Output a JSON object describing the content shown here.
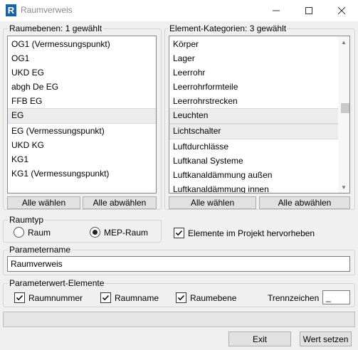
{
  "window": {
    "title": "Raumverweis",
    "app_icon_letter": "R",
    "controls": {
      "minimize": "minimize-icon",
      "maximize": "maximize-icon",
      "close": "close-icon"
    }
  },
  "levels": {
    "legend": "Raumebenen: 1 gewählt",
    "items": [
      "OG1 (Vermessungspunkt)",
      "OG1",
      "UKD EG",
      "abgh De EG",
      "FFB EG",
      "EG",
      "EG (Vermessungspunkt)",
      "UKD KG",
      "KG1",
      "KG1 (Vermessungspunkt)"
    ],
    "selected_index": 5,
    "select_all": "Alle wählen",
    "deselect_all": "Alle abwählen"
  },
  "categories": {
    "legend": "Element-Kategorien: 3 gewählt",
    "items": [
      "Körper",
      "Lager",
      "Leerrohr",
      "Leerrohrformteile",
      "Leerrohrstrecken",
      "Leuchten",
      "Lichtschalter",
      "Luftdurchlässe",
      "Luftkanal Systeme",
      "Luftkanaldämmung außen",
      "Luftkanaldämmung innen"
    ],
    "selected_indices": [
      5,
      6
    ],
    "select_all": "Alle wählen",
    "deselect_all": "Alle abwählen",
    "scroll_position": 0.45
  },
  "raumtyp": {
    "legend": "Raumtyp",
    "option_raum": "Raum",
    "option_mep": "MEP-Raum",
    "selected": "MEP-Raum"
  },
  "highlight": {
    "label": "Elemente im Projekt hervorheben",
    "checked": true
  },
  "parametername": {
    "legend": "Parametername",
    "value": "Raumverweis"
  },
  "paramvalues": {
    "legend": "Parameterwert-Elemente",
    "raumnummer": {
      "label": "Raumnummer",
      "checked": true
    },
    "raumname": {
      "label": "Raumname",
      "checked": true
    },
    "raumebene": {
      "label": "Raumebene",
      "checked": true
    },
    "separator_label": "Trennzeichen",
    "separator_value": "_"
  },
  "progress": {
    "value": 0
  },
  "actions": {
    "exit": "Exit",
    "apply": "Wert setzen"
  }
}
